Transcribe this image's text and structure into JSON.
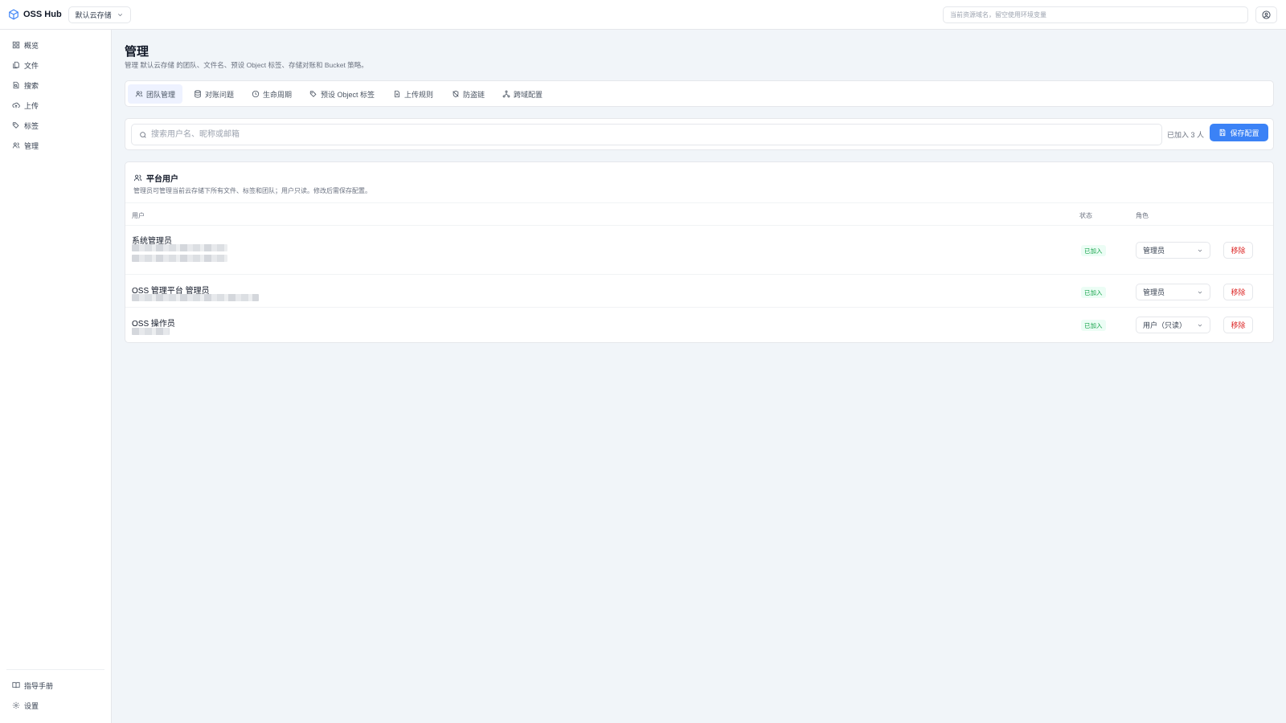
{
  "header": {
    "brand_name": "OSS Hub",
    "storage_selected": "默认云存储",
    "domain_placeholder": "当前资源域名，留空使用环境变量"
  },
  "sidebar": {
    "items": [
      {
        "label": "概览",
        "icon": "grid-icon"
      },
      {
        "label": "文件",
        "icon": "files-icon"
      },
      {
        "label": "搜索",
        "icon": "search-doc-icon"
      },
      {
        "label": "上传",
        "icon": "cloud-upload-icon"
      },
      {
        "label": "标签",
        "icon": "tags-icon"
      },
      {
        "label": "管理",
        "icon": "users-icon"
      }
    ],
    "bottom_items": [
      {
        "label": "指导手册",
        "icon": "book-icon"
      },
      {
        "label": "设置",
        "icon": "gear-icon"
      }
    ]
  },
  "page": {
    "title": "管理",
    "description": "管理 默认云存储 的团队、文件名、预设 Object 标签、存储对账和 Bucket 策略。"
  },
  "tabs": [
    {
      "label": "团队管理",
      "icon": "users-icon",
      "active": true
    },
    {
      "label": "对账问题",
      "icon": "database-icon",
      "active": false
    },
    {
      "label": "生命周期",
      "icon": "clock-icon",
      "active": false
    },
    {
      "label": "预设 Object 标签",
      "icon": "tags-icon",
      "active": false
    },
    {
      "label": "上传规则",
      "icon": "file-upload-icon",
      "active": false
    },
    {
      "label": "防盗链",
      "icon": "shield-off-icon",
      "active": false
    },
    {
      "label": "跨域配置",
      "icon": "network-icon",
      "active": false
    }
  ],
  "toolbar": {
    "search_placeholder": "搜索用户名、昵称或邮箱",
    "count_text": "已加入 3 人",
    "save_label": "保存配置"
  },
  "users_section": {
    "title": "平台用户",
    "description": "管理员可管理当前云存储下所有文件、标签和团队；用户只读。修改后需保存配置。",
    "columns": {
      "user": "用户",
      "status": "状态",
      "role": "角色"
    },
    "rows": [
      {
        "name": "系统管理员",
        "status": "已加入",
        "role": "管理员",
        "action": "移除"
      },
      {
        "name": "OSS 管理平台 管理员",
        "status": "已加入",
        "role": "管理员",
        "action": "移除"
      },
      {
        "name": "OSS 操作员",
        "status": "已加入",
        "role": "用户（只读）",
        "action": "移除"
      }
    ]
  },
  "colors": {
    "accent": "#3b82f6",
    "danger": "#dc2626",
    "success": "#16a34a",
    "background": "#f1f5f9"
  }
}
